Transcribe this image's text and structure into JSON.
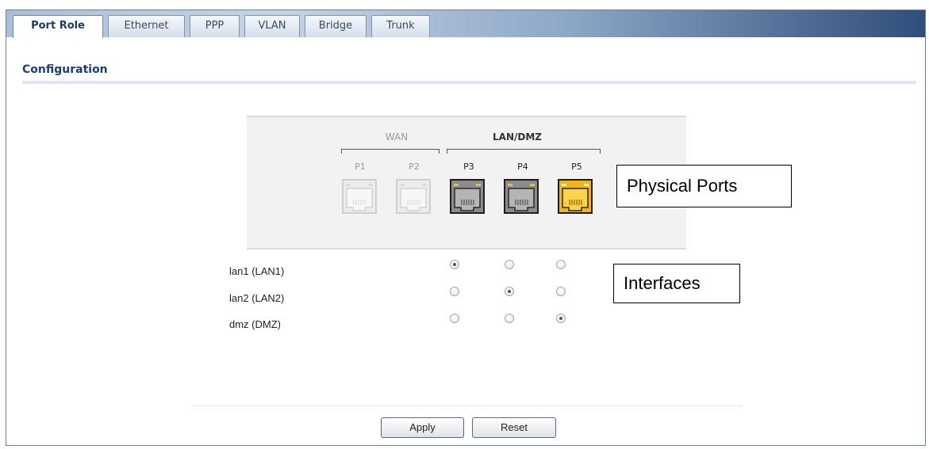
{
  "tabs": [
    {
      "label": "Port Role",
      "active": true
    },
    {
      "label": "Ethernet"
    },
    {
      "label": "PPP"
    },
    {
      "label": "VLAN"
    },
    {
      "label": "Bridge"
    },
    {
      "label": "Trunk"
    }
  ],
  "section": {
    "title": "Configuration"
  },
  "ports_panel": {
    "groups": [
      {
        "label": "WAN",
        "color": "#9a9a9a"
      },
      {
        "label": "LAN/DMZ",
        "color": "#333333"
      }
    ],
    "ports": [
      {
        "label": "P1",
        "state": "disabled",
        "color": "#e6e6e6"
      },
      {
        "label": "P2",
        "state": "disabled",
        "color": "#e6e6e6"
      },
      {
        "label": "P3",
        "state": "lan",
        "color": "#8c8c8c"
      },
      {
        "label": "P4",
        "state": "lan",
        "color": "#8c8c8c"
      },
      {
        "label": "P5",
        "state": "dmz",
        "color": "#f2b418"
      }
    ]
  },
  "interfaces": [
    {
      "label": "lan1 (LAN1)",
      "selected_port_index": 0
    },
    {
      "label": "lan2 (LAN2)",
      "selected_port_index": 1
    },
    {
      "label": "dmz (DMZ)",
      "selected_port_index": 2
    }
  ],
  "callouts": {
    "physical_ports": "Physical Ports",
    "interfaces": "Interfaces"
  },
  "buttons": {
    "apply": "Apply",
    "reset": "Reset"
  }
}
